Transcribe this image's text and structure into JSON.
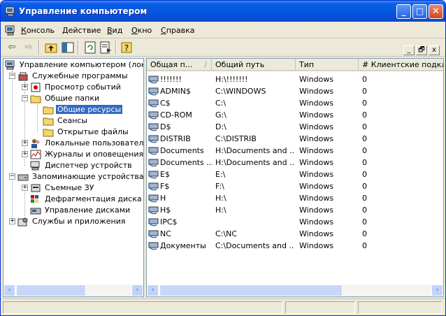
{
  "window": {
    "title": "Управление компьютером",
    "buttons": {
      "minimize": "_",
      "maximize": "□",
      "close": "✕"
    }
  },
  "menu": [
    {
      "label": "Консоль",
      "accel": "К"
    },
    {
      "label": "Действие",
      "accel": "Д"
    },
    {
      "label": "Вид",
      "accel": "В"
    },
    {
      "label": "Окно",
      "accel": "О"
    },
    {
      "label": "Справка",
      "accel": "С"
    }
  ],
  "mdi": {
    "minimize": "_",
    "restore": "🗗",
    "close": "x"
  },
  "toolbar": {
    "back": "⇦",
    "forward": "⇨",
    "up": "📁",
    "show_hide_tree": "▥",
    "refresh": "🗘",
    "export": "⇲",
    "help": "❓"
  },
  "tree": [
    {
      "label": "Управление компьютером (локаль",
      "icon": "computer-icon"
    },
    {
      "label": "Служебные программы",
      "icon": "tools-icon"
    },
    {
      "label": "Просмотр событий",
      "icon": "event-viewer-icon"
    },
    {
      "label": "Общие папки",
      "icon": "folder-icon"
    },
    {
      "label": "Общие ресурсы",
      "icon": "folder-icon",
      "selected": true
    },
    {
      "label": "Сеансы",
      "icon": "folder-icon"
    },
    {
      "label": "Открытые файлы",
      "icon": "folder-icon"
    },
    {
      "label": "Локальные пользователи и",
      "icon": "users-icon"
    },
    {
      "label": "Журналы и оповещения пр",
      "icon": "performance-icon"
    },
    {
      "label": "Диспетчер устройств",
      "icon": "device-manager-icon"
    },
    {
      "label": "Запоминающие устройства",
      "icon": "storage-icon"
    },
    {
      "label": "Съемные ЗУ",
      "icon": "removable-storage-icon"
    },
    {
      "label": "Дефрагментация диска",
      "icon": "defrag-icon"
    },
    {
      "label": "Управление дисками",
      "icon": "disk-management-icon"
    },
    {
      "label": "Службы и приложения",
      "icon": "services-icon"
    }
  ],
  "columns": [
    "Общая п...",
    "Общий путь",
    "Тип",
    "# Клиентские подклю"
  ],
  "sort_indicator": "/",
  "shares": [
    {
      "name": "!!!!!!!",
      "path": "H:\\!!!!!!!",
      "type": "Windows",
      "clients": "0"
    },
    {
      "name": "ADMIN$",
      "path": "C:\\WINDOWS",
      "type": "Windows",
      "clients": "0"
    },
    {
      "name": "C$",
      "path": "C:\\",
      "type": "Windows",
      "clients": "0"
    },
    {
      "name": "CD-ROM",
      "path": "G:\\",
      "type": "Windows",
      "clients": "0"
    },
    {
      "name": "D$",
      "path": "D:\\",
      "type": "Windows",
      "clients": "0"
    },
    {
      "name": "DISTRIB",
      "path": "C:\\DISTRIB",
      "type": "Windows",
      "clients": "0"
    },
    {
      "name": "Documents",
      "path": "H:\\Documents and ...",
      "type": "Windows",
      "clients": "0"
    },
    {
      "name": "Documents ...",
      "path": "H:\\Documents and ...",
      "type": "Windows",
      "clients": "0"
    },
    {
      "name": "E$",
      "path": "E:\\",
      "type": "Windows",
      "clients": "0"
    },
    {
      "name": "F$",
      "path": "F:\\",
      "type": "Windows",
      "clients": "0"
    },
    {
      "name": "H",
      "path": "H:\\",
      "type": "Windows",
      "clients": "0"
    },
    {
      "name": "H$",
      "path": "H:\\",
      "type": "Windows",
      "clients": "0"
    },
    {
      "name": "IPC$",
      "path": "",
      "type": "Windows",
      "clients": "0"
    },
    {
      "name": "NC",
      "path": "C:\\NC",
      "type": "Windows",
      "clients": "0"
    },
    {
      "name": "Документы",
      "path": "C:\\Documents and ...",
      "type": "Windows",
      "clients": "0"
    }
  ],
  "scroll": {
    "left": "‹",
    "right": "›"
  },
  "colors": {
    "titlebar": "#0654e0",
    "selection": "#316ac5",
    "chrome": "#ece9d8"
  }
}
